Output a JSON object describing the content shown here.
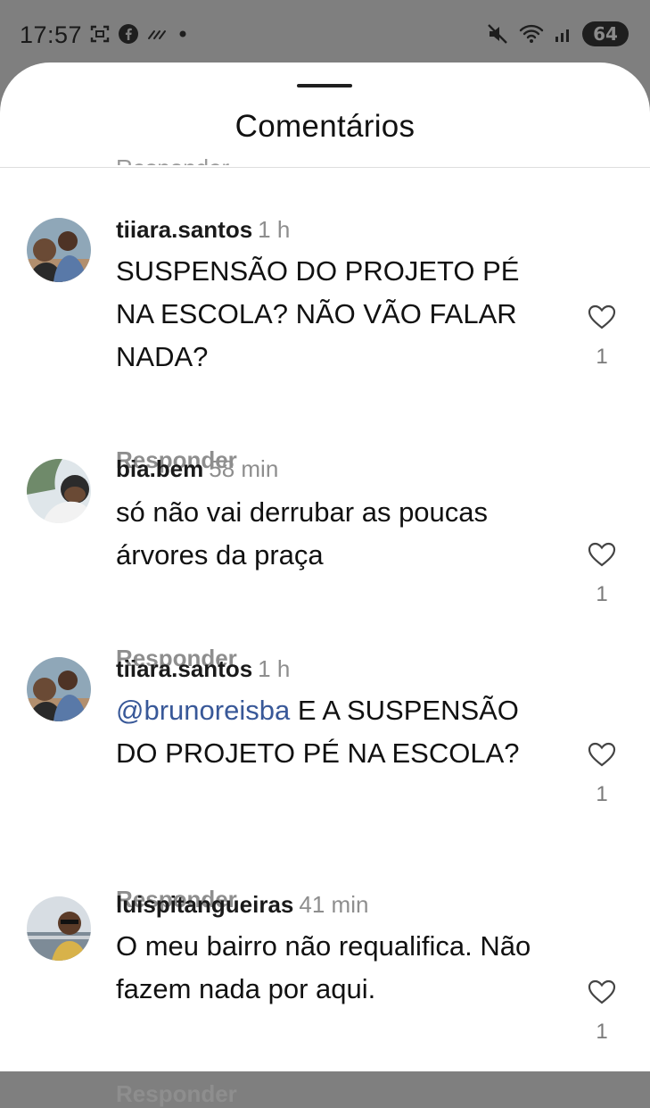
{
  "status_bar": {
    "time": "17:57",
    "left_icons": [
      "screenshot-icon",
      "facebook-icon",
      "wind-icon",
      "dot-icon"
    ],
    "right_icons": [
      "mute-icon",
      "wifi-icon",
      "signal-icon"
    ],
    "battery": "64"
  },
  "sheet": {
    "title": "Comentários",
    "cutoff_text": "Responder"
  },
  "comments": [
    {
      "username": "tiiara.santos",
      "time": "1 h",
      "mention": "",
      "text": "SUSPENSÃO DO PROJETO PÉ NA ESCOLA? NÃO VÃO FALAR NADA?",
      "reply_label": "Responder",
      "likes": "1"
    },
    {
      "username": "bia.bem",
      "time": "58 min",
      "mention": "",
      "text": "só não vai derrubar as poucas árvores da praça",
      "reply_label": "Responder",
      "likes": "1"
    },
    {
      "username": "tiiara.santos",
      "time": "1 h",
      "mention": "@brunoreisba",
      "text": " E A SUSPENSÃO DO PROJETO PÉ NA ESCOLA?",
      "reply_label": "Responder",
      "likes": "1"
    },
    {
      "username": "luispitangueiras",
      "time": "41 min",
      "mention": "",
      "text": "O meu bairro não requalifica. Não fazem nada por aqui.",
      "reply_label": "Responder",
      "likes": "1"
    }
  ]
}
